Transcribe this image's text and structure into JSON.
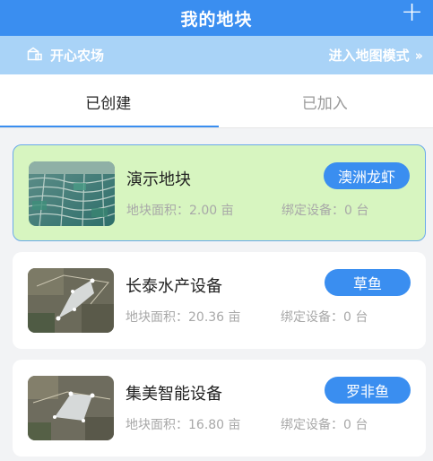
{
  "header": {
    "title": "我的地块",
    "add_icon": "plus-icon"
  },
  "farm_bar": {
    "farm_icon": "farm-icon",
    "farm_name": "开心农场",
    "map_mode_label": "进入地图模式",
    "map_mode_icon": "double-chevron-right-icon"
  },
  "tabs": [
    {
      "label": "已创建",
      "active": true
    },
    {
      "label": "已加入",
      "active": false
    }
  ],
  "plots": [
    {
      "name": "演示地块",
      "area": "地块面积：2.00 亩",
      "devices": "绑定设备：0 台",
      "tag": "澳洲龙虾",
      "selected": true,
      "thumb": "rice-terraces"
    },
    {
      "name": "长泰水产设备",
      "area": "地块面积：20.36 亩",
      "devices": "绑定设备：0 台",
      "tag": "草鱼",
      "selected": false,
      "thumb": "satellite-polygon"
    },
    {
      "name": "集美智能设备",
      "area": "地块面积：16.80 亩",
      "devices": "绑定设备：0 台",
      "tag": "罗非鱼",
      "selected": false,
      "thumb": "satellite-polygon"
    }
  ],
  "colors": {
    "primary": "#3a8ef0",
    "farm_bar": "#a9d3f7",
    "selected_card": "#d7f5c0"
  }
}
